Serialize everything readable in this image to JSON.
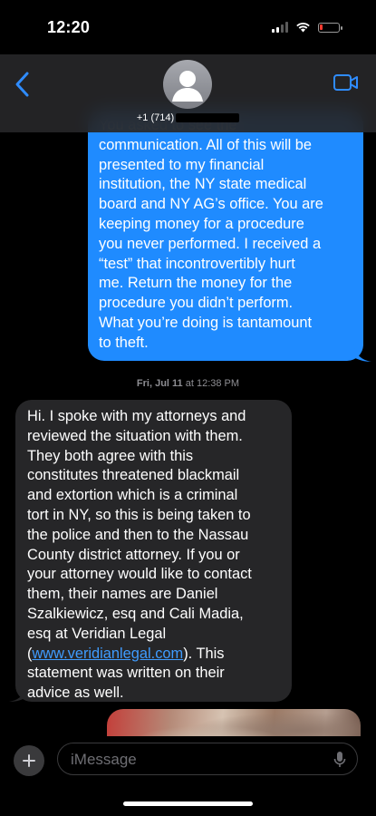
{
  "status_bar": {
    "time": "12:20"
  },
  "header": {
    "contact_number": "+1 (714)",
    "icons": {
      "back": "chevron-left-icon",
      "avatar": "person-silhouette-icon",
      "video": "facetime-video-icon"
    },
    "accent_color": "#2f8cff"
  },
  "messages": [
    {
      "direction": "outgoing",
      "text": "You asked to see the\ncommunication. All of this will be\npresented to my financial\ninstitution, the NY state medical\nboard and NY AG’s office. You are\nkeeping money for a procedure\nyou never performed. I received a\n“test” that incontrovertibly hurt\nme. Return the money for the\nprocedure you didn’t perform.\nWhat you’re doing is tantamount\nto theft."
    },
    {
      "direction": "incoming",
      "timestamp_day": "Fri, Jul 11",
      "timestamp_time": "at 12:38 PM",
      "text_before_link": "Hi. I spoke with my attorneys and\nreviewed the situation with them.\nThey both agree with this\nconstitutes threatened blackmail\nand extortion which is a criminal\ntort in NY, so this is being taken to\nthe police and then to the Nassau\nCounty district attorney. If you or\nyour attorney would like to contact\nthem, their names are Daniel\nSzalkiewicz, esq and Cali Madia,\nesq at Veridian Legal\n(",
      "link_text": "www.veridianlegal.com",
      "text_after_link": "). This\nstatement was written on their\nadvice as well."
    }
  ],
  "input": {
    "placeholder": "iMessage",
    "value": ""
  },
  "colors": {
    "outgoing_bubble": "#1f8bff",
    "incoming_bubble": "#262628",
    "background": "#000000"
  }
}
